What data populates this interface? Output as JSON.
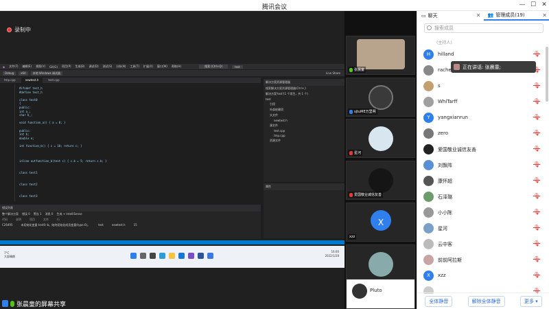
{
  "window": {
    "title": "腾讯会议",
    "min": "—",
    "max": "☐",
    "close": "✕"
  },
  "recording": {
    "label": "录制中"
  },
  "vs": {
    "menu": [
      "文件(F)",
      "编辑(E)",
      "视图(V)",
      "Git(G)",
      "项目(P)",
      "生成(B)",
      "调试(D)",
      "测试(S)",
      "分析(N)",
      "工具(T)",
      "扩展(X)",
      "窗口(W)",
      "帮助(H)"
    ],
    "search": "搜索 (Ctrl+Q)",
    "project": "test",
    "toolbar": [
      "Debug",
      "x64",
      "本地 Windows 调试器"
    ],
    "live_share": "Live Share",
    "tabs": [
      "tmp.cpp",
      "newtest.h",
      "test.cpp"
    ],
    "code_lines": [
      "#ifndef test_h",
      "#define test_h",
      "",
      "class test0",
      "{",
      "public:",
      "  int a_;",
      "  char b_;",
      "",
      "  void function_a() { a = 0; }",
      "",
      "public:",
      "  int b;",
      "  double e;",
      "",
      "  int function_b() { c = 10; return c; }",
      "",
      "",
      "",
      "inline outfunction_b(test c) { c.b = 5; return c.b; }",
      "",
      "",
      "class test1",
      "",
      "",
      "class test2",
      "",
      "",
      "class test3"
    ],
    "solution_title": "解决方案资源管理器",
    "solution_items": [
      "搜索解决方案资源管理器(Ctrl+;)",
      "解决方案'test'(1 个项目，共 1 个)",
      "test",
      "引用",
      "外部依赖项",
      "头文件",
      "newtest.h",
      "源文件",
      "test.cpp",
      "tmp.cpp",
      "资源文件"
    ],
    "props_title": "属性",
    "error_title": "错误列表",
    "error_scope": "整个解决方案",
    "error_counts": [
      "错误 0",
      "警告 1",
      "消息 0"
    ],
    "build": "生成 + IntelliSense",
    "error_cols": [
      "代码",
      "说明",
      "项目",
      "文件",
      "行"
    ],
    "error_row": [
      "C26495",
      "未初始化变量 test0::b。始终初始化成员变量(type.6)。",
      "test",
      "newtest.h",
      "15"
    ],
    "weather": [
      "7°C",
      "大部晴朗"
    ],
    "tray": [
      "16:00",
      "2022/1/28"
    ]
  },
  "sharer": {
    "label": "张晨童的屏幕共享"
  },
  "videos": [
    {
      "name": "张晨童"
    },
    {
      "name": "sjtuME万里明"
    },
    {
      "name": "星河"
    },
    {
      "name": "爱国敬业诚信友善"
    },
    {
      "name": "xzz",
      "avatar_letter": "X"
    },
    {
      "name": ""
    },
    {
      "name": "Pluto"
    }
  ],
  "panel": {
    "tab_chat": "聊天",
    "tab_members": "管理成员(19)",
    "search_placeholder": "搜索成员",
    "host_tag": "(主持人)",
    "speaking": "正在讲话: 张晨童;",
    "members": [
      {
        "name": "hilland",
        "letter": "H",
        "color": "#2f80ed"
      },
      {
        "name": "rache",
        "letter": "",
        "color": "#888888"
      },
      {
        "name": "s",
        "letter": "",
        "color": "#c4a070"
      },
      {
        "name": "WhiTarff",
        "letter": "",
        "color": "#a0a0a0"
      },
      {
        "name": "yangxianrun",
        "letter": "Y",
        "color": "#2f80ed"
      },
      {
        "name": "zero",
        "letter": "",
        "color": "#777777"
      },
      {
        "name": "爱国敬业诚信友善",
        "letter": "",
        "color": "#222222"
      },
      {
        "name": "刘飘阵",
        "letter": "",
        "color": "#5a8fd6"
      },
      {
        "name": "康怀超",
        "letter": "",
        "color": "#555555"
      },
      {
        "name": "石泽璐",
        "letter": "",
        "color": "#6c9c6c"
      },
      {
        "name": "小小陈",
        "letter": "",
        "color": "#999999"
      },
      {
        "name": "星河",
        "letter": "",
        "color": "#7aa0c8"
      },
      {
        "name": "云中客",
        "letter": "",
        "color": "#bbbbbb"
      },
      {
        "name": "前前阿拉斯",
        "letter": "",
        "color": "#c7a5a5"
      },
      {
        "name": "xzz",
        "letter": "X",
        "color": "#2f80ed"
      },
      {
        "name": "",
        "letter": "",
        "color": "#cccccc"
      }
    ],
    "buttons": [
      "全体静音",
      "解除全体静音",
      "更多 ▾"
    ]
  }
}
